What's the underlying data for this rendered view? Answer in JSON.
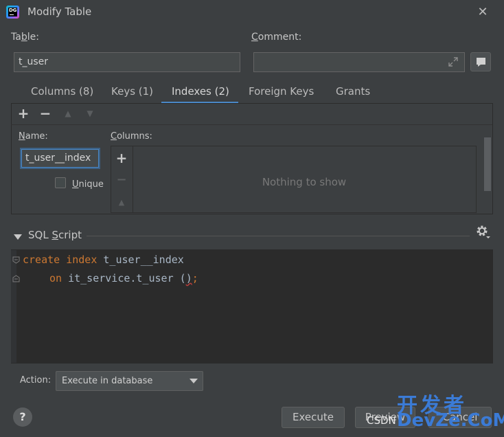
{
  "window": {
    "title": "Modify Table",
    "close_icon": "✕"
  },
  "form": {
    "table_label_prefix": "Ta",
    "table_label_mnemonic": "b",
    "table_label_suffix": "le:",
    "table_value": "t_user",
    "comment_label_mnemonic": "C",
    "comment_label_suffix": "omment:",
    "comment_value": ""
  },
  "tabs": [
    {
      "label": "Columns (8)"
    },
    {
      "label": "Keys (1)"
    },
    {
      "label": "Indexes (2)",
      "active": true
    },
    {
      "label": "Foreign Keys"
    },
    {
      "label": "Grants"
    }
  ],
  "index_editor": {
    "toolbar": {
      "add": "+",
      "remove": "−",
      "up": "▲",
      "down": "▼"
    },
    "name_label_mnemonic": "N",
    "name_label_suffix": "ame:",
    "name_value": "t_user__index",
    "columns_label_mnemonic": "C",
    "columns_label_suffix": "olumns:",
    "unique_label_mnemonic": "U",
    "unique_label_suffix": "nique",
    "unique_checked": false,
    "columns_toolbar": {
      "add": "+",
      "remove": "−",
      "up": "▲"
    },
    "empty_text": "Nothing to show"
  },
  "sql": {
    "label_prefix": "SQL ",
    "label_mnemonic": "S",
    "label_suffix": "cript",
    "line1_kw1": "create",
    "line1_kw2": "index",
    "line1_name": "t_user__index",
    "line2_kw": "on",
    "line2_target": "it_service.t_user ",
    "line2_paren": "(",
    "line2_close": ")",
    "line2_semi": ";"
  },
  "footer": {
    "action_label": "Action:",
    "action_value": "Execute in database",
    "help": "?",
    "execute": "Execute",
    "preview": "Preview",
    "cancel": "Cancel"
  },
  "watermark": {
    "csdn": "CSDN",
    "cn": "开发者",
    "en": "DevZe.CoM"
  },
  "colors": {
    "background": "#3c3f41",
    "accent": "#4a88c7",
    "keyword": "#cc7832",
    "editor_bg": "#2b2b2b"
  }
}
